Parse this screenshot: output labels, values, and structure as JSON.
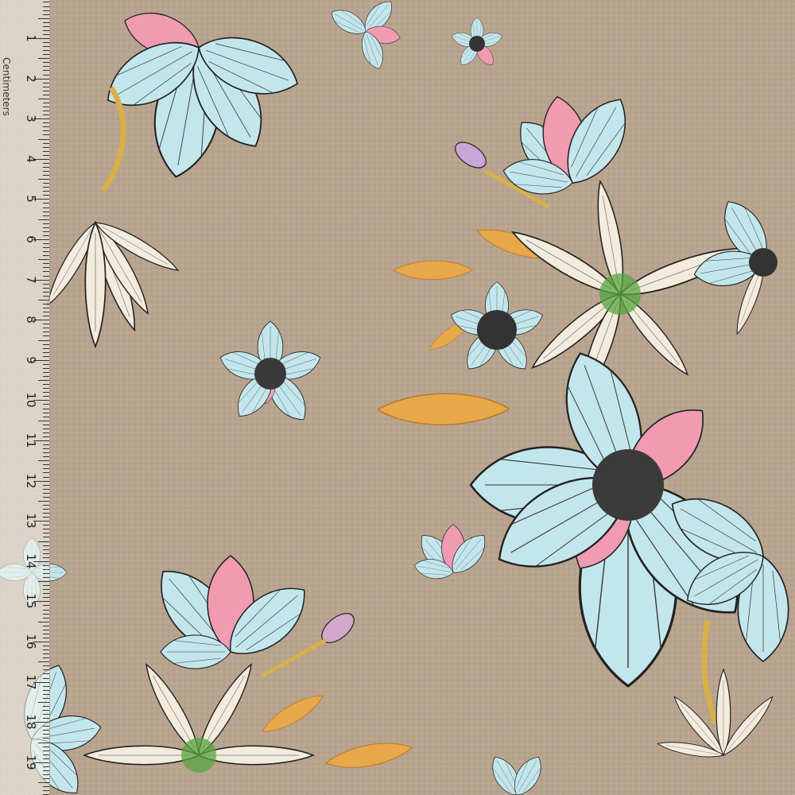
{
  "ruler": {
    "unit_label": "Centimeters",
    "numbers": [
      "1",
      "2",
      "3",
      "4",
      "5",
      "6",
      "7",
      "8",
      "9",
      "10",
      "11",
      "12",
      "13",
      "14",
      "15",
      "16",
      "17",
      "18",
      "19",
      "2"
    ]
  },
  "fabric": {
    "base_color": "#b9a48f",
    "palette": {
      "aqua": "#bfe4ea",
      "pink": "#ef8fa8",
      "cream": "#f3eadb",
      "gold": "#e6a545",
      "green": "#4c9a3a",
      "ink": "#222222"
    }
  }
}
